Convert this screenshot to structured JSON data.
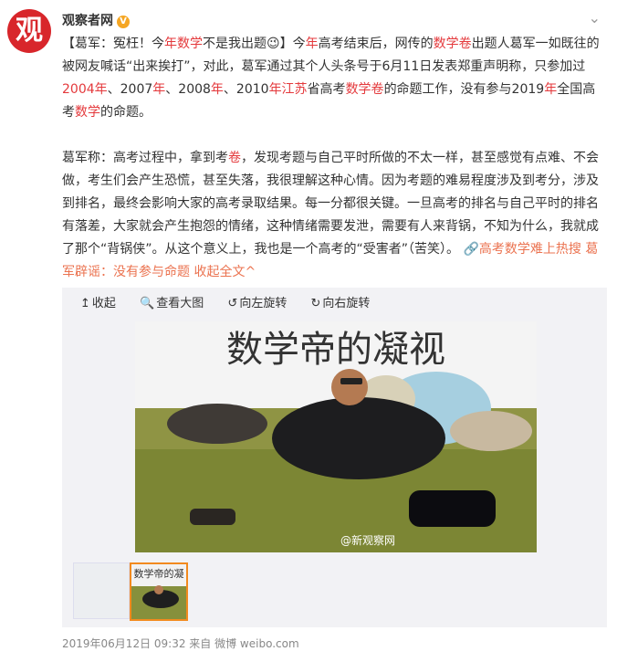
{
  "post": {
    "author": "观察者网",
    "avatar_char": "观",
    "verified_mark": "V",
    "more_icon": "chevron-down-icon",
    "p1": {
      "a": "【葛军：冤枉！今",
      "b": "年",
      "c": "数学",
      "d": "不是我出题",
      "emoji": "😉",
      "e": "】今",
      "f": "年",
      "g": "高考结束后，网传的",
      "h": "数学卷",
      "i": "出题人葛军一如既往的被网友喊话“出来挨打”，对此，葛军通过其个人头条号于6月11日发表郑重声明称，只参加过",
      "j": "2004年",
      "k": "、2007",
      "l": "年",
      "m": "、2008",
      "n": "年",
      "o": "、2010",
      "p": "年江苏",
      "q": "省高考",
      "r": "数学卷",
      "s": "的命题工作，没有参与2019",
      "t": "年",
      "u": "全国高考",
      "v": "数学",
      "w": "的命题。"
    },
    "p2": {
      "a": "葛军称：高考过程中，拿到考",
      "b": "卷",
      "c": "，发现考题与自己平时所做的不太一样，甚至感觉有点难、不会做，考生们会产生恐慌，甚至失落，我很理解这种心情。因为考题的难易程度涉及到考分，涉及到排名，最终会影响大家的高考录取结果。每一分都很关键。一旦高考的排名与自己平时的排名有落差，大家就会产生抱怨的情绪，这种情绪需要发泄，需要有人来背锅，不知为什么，我就成了那个“背锅侠”。从这个意义上，我也是一个高考的“受害者”（苦笑）。",
      "link_icon": "🔗",
      "link1_pre": "高考",
      "link1_mid": "数学",
      "link1_post": "难上热搜 葛军辟谣：没有参与命题",
      "collapse": "收起全文",
      "collapse_icon": "^"
    },
    "toolbar": {
      "collapse_label": "收起",
      "view_label": "查看大图",
      "rotate_left_label": "向左旋转",
      "rotate_right_label": "向右旋转",
      "collapse_icon": "↥",
      "view_icon": "🔍",
      "rotate_left_icon": "↺",
      "rotate_right_icon": "↻"
    },
    "image": {
      "caption": "数学帝的凝视",
      "watermark": "@新观察网"
    },
    "thumb_caption": "数学帝的凝",
    "footer": "2019年06月12日 09:32  来自 微博 weibo.com",
    "colors": {
      "accent": "#e4393c",
      "link": "#eb7350",
      "brand": "#d8262b"
    }
  }
}
